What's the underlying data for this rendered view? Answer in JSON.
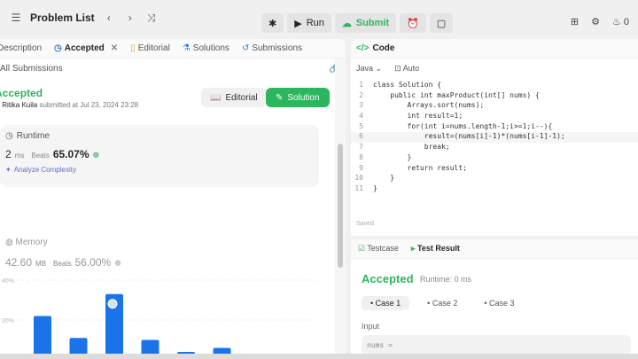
{
  "topbar": {
    "title": "Problem List",
    "run_label": "Run",
    "submit_label": "Submit",
    "count": "0"
  },
  "tabs": {
    "description": "Description",
    "accepted": "Accepted",
    "editorial": "Editorial",
    "solutions": "Solutions",
    "submissions": "Submissions"
  },
  "submission": {
    "all_submissions": "All Submissions",
    "status": "Accepted",
    "author": "Ritika Kuila",
    "submitted_text": "submitted at Jul 23, 2024 23:28",
    "editorial_btn": "Editorial",
    "solution_btn": "Solution",
    "runtime": {
      "label": "Runtime",
      "value": "2",
      "unit": "ms",
      "beats_label": "Beats",
      "beats": "65.07%",
      "analyze": "Analyze Complexity"
    },
    "memory": {
      "label": "Memory",
      "value": "42.60",
      "unit": "MB",
      "beats_label": "Beats",
      "beats": "56.00%"
    }
  },
  "chart_data": {
    "type": "bar",
    "yticks": [
      "40%",
      "20%"
    ],
    "values": [
      22,
      11,
      33,
      10,
      4,
      6,
      0.5
    ],
    "ylim": [
      0,
      40
    ],
    "highlight_index": 2,
    "grid": true
  },
  "editor": {
    "header": "Code",
    "language": "Java",
    "auto_label": "Auto",
    "saved_label": "Saved",
    "lines": [
      "class Solution {",
      "    public int maxProduct(int[] nums) {",
      "        Arrays.sort(nums);",
      "        int result=1;",
      "        for(int i=nums.length-1;i>=1;i--){",
      "            result=(nums[i]-1)*(nums[i-1]-1);",
      "            break;",
      "        }",
      "        return result;",
      "    }",
      "}"
    ],
    "line_numbers": [
      "1",
      "2",
      "3",
      "4",
      "5",
      "6",
      "7",
      "8",
      "9",
      "10",
      "11"
    ]
  },
  "result": {
    "testcase_tab": "Testcase",
    "result_tab": "Test Result",
    "status": "Accepted",
    "runtime": "Runtime: 0 ms",
    "cases": [
      "Case 1",
      "Case 2",
      "Case 3"
    ],
    "input_label": "Input",
    "input_value": "nums ="
  },
  "colors": {
    "accent_green": "#2db55d",
    "bar_blue": "#1a73e8"
  }
}
